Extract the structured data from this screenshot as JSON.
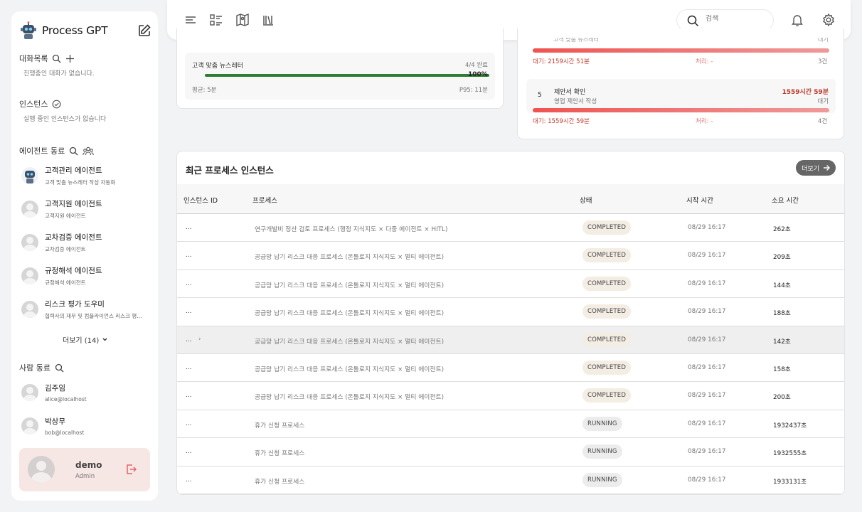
{
  "app": {
    "title": "Process GPT"
  },
  "sidebar": {
    "chats_title": "대화목록",
    "chats_empty": "진행중인 대화가 없습니다.",
    "instances_title": "인스턴스",
    "instances_empty": "실행 중인 인스턴스가 없습니다",
    "agents_title": "에이전트 동료",
    "agents": [
      {
        "name": "고객관리 에이전트",
        "desc": "고객 맞춤 뉴스레터 작성 자동화"
      },
      {
        "name": "고객지원 에이전트",
        "desc": "고객지원 에이전트"
      },
      {
        "name": "교차검증 에이전트",
        "desc": "교차검증 에이전트"
      },
      {
        "name": "규정해석 에이전트",
        "desc": "규정해석 에이전트"
      },
      {
        "name": "리스크 평가 도우미",
        "desc": "협력사의 재무 및 컴플라이언스 리스크 평가 ..."
      }
    ],
    "more_label": "더보기 (14)",
    "people_title": "사람 동료",
    "people": [
      {
        "name": "김주임",
        "email": "alice@localhost"
      },
      {
        "name": "박상무",
        "email": "bob@localhost"
      }
    ],
    "user": {
      "name": "demo",
      "role": "Admin"
    }
  },
  "topbar": {
    "search_placeholder": "검색"
  },
  "newsletter": {
    "name": "고객 맞춤 뉴스레터",
    "count": "4/4 완료",
    "percent": "100%",
    "progress": 1.0,
    "avg": "평균: 5분",
    "p95": "P95: 11분"
  },
  "queue": {
    "cut_sub": "고객 맞춤 뉴스레터",
    "cut_state": "대기",
    "row1": {
      "wait": "대기: 2159시간 51분",
      "proc": "처리: -",
      "count": "3건"
    },
    "row2": {
      "num": "5",
      "name": "제안서 확인",
      "sub": "영업 제안서 작성",
      "time": "1559시간 59분",
      "state": "대기",
      "wait": "대기: 1559시간 59분",
      "proc": "처리: -",
      "count": "4건"
    }
  },
  "table": {
    "title": "최근 프로세스 인스턴스",
    "more_label": "더보기",
    "headers": [
      "인스턴스 ID",
      "프로세스",
      "상태",
      "시작 시간",
      "소요 시간"
    ],
    "rows": [
      {
        "id": "...",
        "process": "연구개발비 정산 검토 프로세스 (행정 지식지도 × 다중 에이전트 × HITL)",
        "status": "COMPLETED",
        "start": "08/29 16:17",
        "duration": "262초"
      },
      {
        "id": "...",
        "process": "공급망 납기 리스크 대응 프로세스 (온톨로지 지식지도 × 멀티 에이전트)",
        "status": "COMPLETED",
        "start": "08/29 16:17",
        "duration": "209초"
      },
      {
        "id": "...",
        "process": "공급망 납기 리스크 대응 프로세스 (온톨로지 지식지도 × 멀티 에이전트)",
        "status": "COMPLETED",
        "start": "08/29 16:17",
        "duration": "144초"
      },
      {
        "id": "...",
        "process": "공급망 납기 리스크 대응 프로세스 (온톨로지 지식지도 × 멀티 에이전트)",
        "status": "COMPLETED",
        "start": "08/29 16:17",
        "duration": "188초"
      },
      {
        "id": "...",
        "process": "공급망 납기 리스크 대응 프로세스 (온톨로지 지식지도 × 멀티 에이전트)",
        "status": "COMPLETED",
        "start": "08/29 16:17",
        "duration": "142초"
      },
      {
        "id": "...",
        "process": "공급망 납기 리스크 대응 프로세스 (온톨로지 지식지도 × 멀티 에이전트)",
        "status": "COMPLETED",
        "start": "08/29 16:17",
        "duration": "158초"
      },
      {
        "id": "...",
        "process": "공급망 납기 리스크 대응 프로세스 (온톨로지 지식지도 × 멀티 에이전트)",
        "status": "COMPLETED",
        "start": "08/29 16:17",
        "duration": "200초"
      },
      {
        "id": "...",
        "process": "휴가 신청 프로세스",
        "status": "RUNNING",
        "start": "08/29 16:17",
        "duration": "1932437초"
      },
      {
        "id": "...",
        "process": "휴가 신청 프로세스",
        "status": "RUNNING",
        "start": "08/29 16:17",
        "duration": "1932555초"
      },
      {
        "id": "...",
        "process": "휴가 신청 프로세스",
        "status": "RUNNING",
        "start": "08/29 16:17",
        "duration": "1933131초"
      }
    ],
    "highlighted_row": 4
  },
  "colors": {
    "progress_green": "#2e7d32",
    "wait_red": "#ef5350",
    "time_red": "#c0392b"
  }
}
